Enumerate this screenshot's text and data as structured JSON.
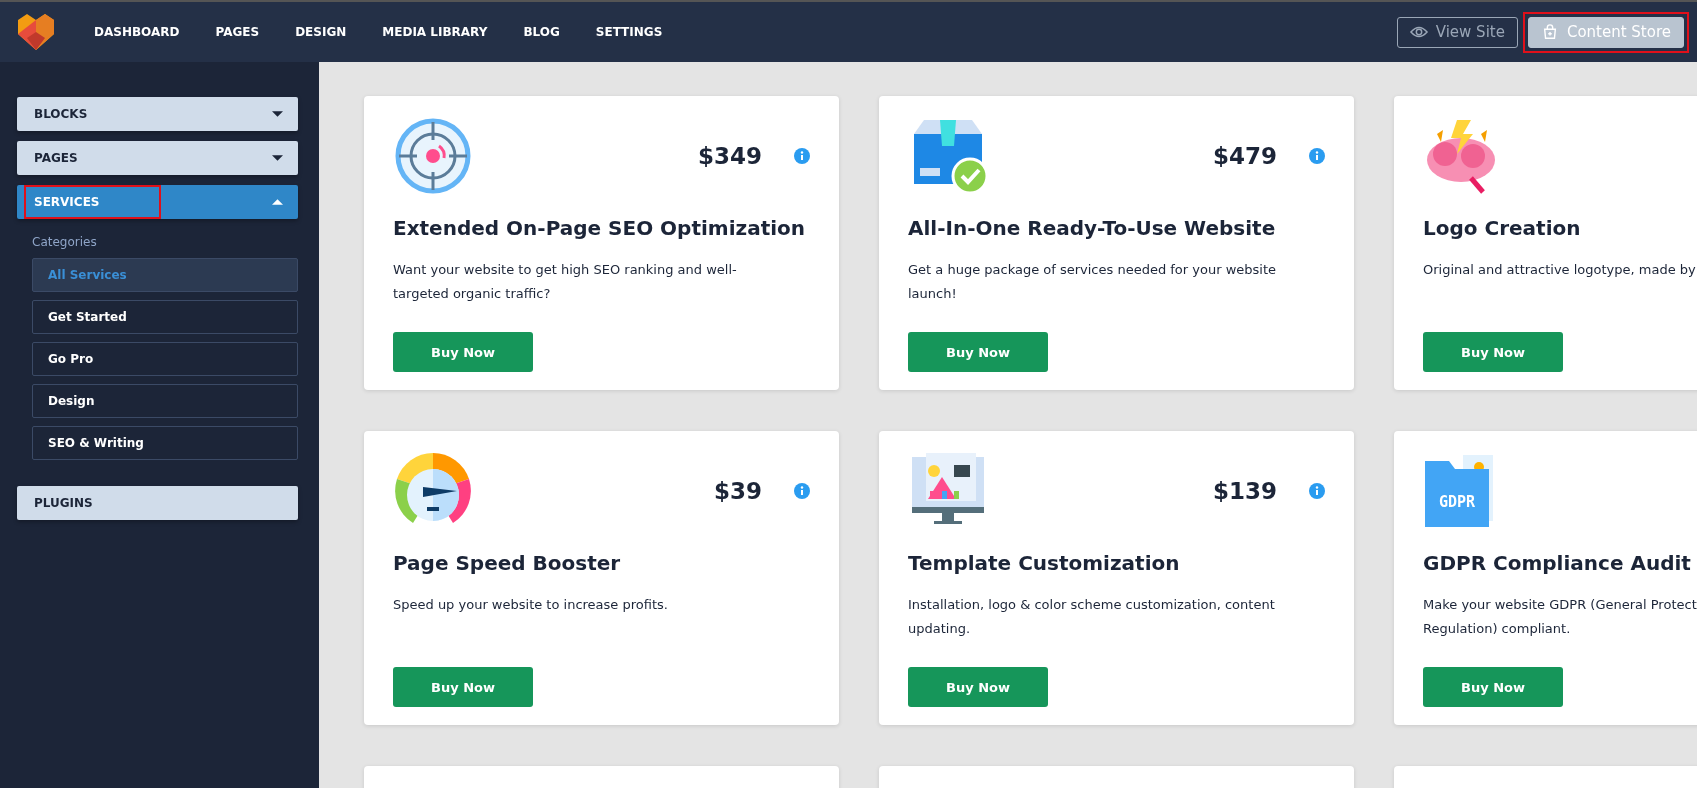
{
  "nav": {
    "items": [
      {
        "label": "DASHBOARD"
      },
      {
        "label": "PAGES"
      },
      {
        "label": "DESIGN"
      },
      {
        "label": "MEDIA LIBRARY"
      },
      {
        "label": "BLOG"
      },
      {
        "label": "SETTINGS"
      }
    ],
    "buttons": [
      {
        "label": "View Site",
        "kind": "outline",
        "highlighted": false
      },
      {
        "label": "Content Store",
        "kind": "filled",
        "highlighted": true
      }
    ]
  },
  "sidebar": {
    "sections": [
      {
        "label": "BLOCKS",
        "expanded": false,
        "highlighted": false
      },
      {
        "label": "PAGES",
        "expanded": false,
        "highlighted": false
      },
      {
        "label": "SERVICES",
        "expanded": true,
        "highlighted": true,
        "categories_label": "Categories",
        "categories": [
          {
            "label": "All Services",
            "selected": true
          },
          {
            "label": "Get Started",
            "selected": false
          },
          {
            "label": "Go Pro",
            "selected": false
          },
          {
            "label": "Design",
            "selected": false
          },
          {
            "label": "SEO & Writing",
            "selected": false
          }
        ]
      },
      {
        "label": "PLUGINS",
        "highlighted": false
      }
    ]
  },
  "cards": [
    {
      "kind": "service",
      "price": "$349",
      "title": "Extended On-Page SEO Optimization",
      "description_lines": [
        "Want your website to get high SEO ranking and well-",
        "targeted organic traffic?"
      ],
      "button": "Buy Now"
    },
    {
      "kind": "service",
      "price": "$479",
      "title": "All-In-One Ready-To-Use Website",
      "description_lines": [
        "Get a huge package of services needed for your website",
        "launch!"
      ],
      "button": "Buy Now"
    },
    {
      "kind": "service",
      "title": "Logo Creation",
      "description_lines": [
        "Original and attractive logotype, made by"
      ],
      "button": "Buy Now"
    },
    {
      "kind": "service",
      "price": "$39",
      "title": "Page Speed Booster",
      "description_lines": [
        "Speed up your website to increase profits."
      ],
      "button": "Buy Now"
    },
    {
      "kind": "service",
      "price": "$139",
      "title": "Template Customization",
      "description_lines": [
        "Installation, logo & color scheme customization, content",
        "updating."
      ],
      "button": "Buy Now"
    },
    {
      "kind": "service",
      "icon_text": "GDPR",
      "title": "GDPR Compliance Audit",
      "description_lines": [
        "Make your website GDPR (General Protect",
        "Regulation) compliant."
      ],
      "button": "Buy Now"
    },
    {
      "kind": "peek"
    },
    {
      "kind": "peek"
    },
    {
      "kind": "peek"
    }
  ]
}
